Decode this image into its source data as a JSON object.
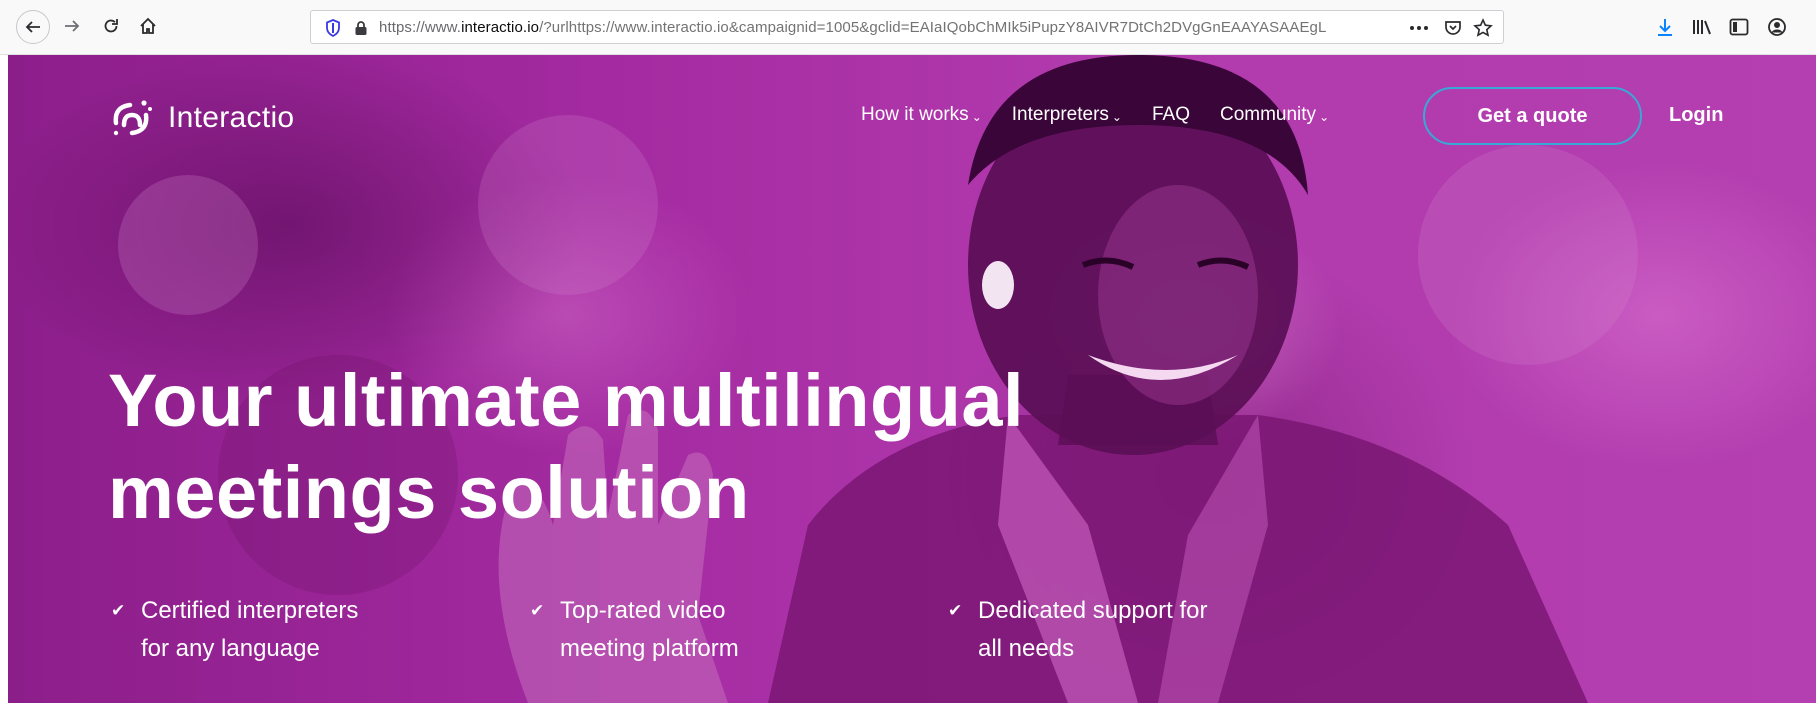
{
  "browser": {
    "url_prefix": "https://www.",
    "url_host": "interactio.io",
    "url_rest": "/?urlhttps://www.interactio.io&campaignid=1005&gclid=EAIaIQobChMIk5iPupzY8AIVR7DtCh2DVgGnEAAYASAAEgL",
    "icons": [
      "back-arrow-icon",
      "forward-arrow-icon",
      "reload-icon",
      "home-icon",
      "shield-icon",
      "lock-icon",
      "more-icon",
      "pocket-icon",
      "star-icon",
      "download-icon",
      "library-icon",
      "sidebar-icon",
      "account-icon"
    ],
    "accent": "#0a84ff"
  },
  "site": {
    "logo_text": "Interactio",
    "nav": [
      {
        "label": "How it works",
        "has_dropdown": true
      },
      {
        "label": "Interpreters",
        "has_dropdown": true
      },
      {
        "label": "FAQ",
        "has_dropdown": false
      },
      {
        "label": "Community",
        "has_dropdown": true
      }
    ],
    "cta_label": "Get a quote",
    "login_label": "Login",
    "headline_line1": "Your ultimate multilingual",
    "headline_line2": "meetings solution",
    "features": [
      {
        "line1": "Certified interpreters",
        "line2": "for any language"
      },
      {
        "line1": "Top-rated video",
        "line2": "meeting platform"
      },
      {
        "line1": "Dedicated support for",
        "line2": "all needs"
      }
    ],
    "colors": {
      "hero_magenta": "#b13aad",
      "cta_border": "#38a9d6",
      "text": "#ffffff"
    }
  }
}
